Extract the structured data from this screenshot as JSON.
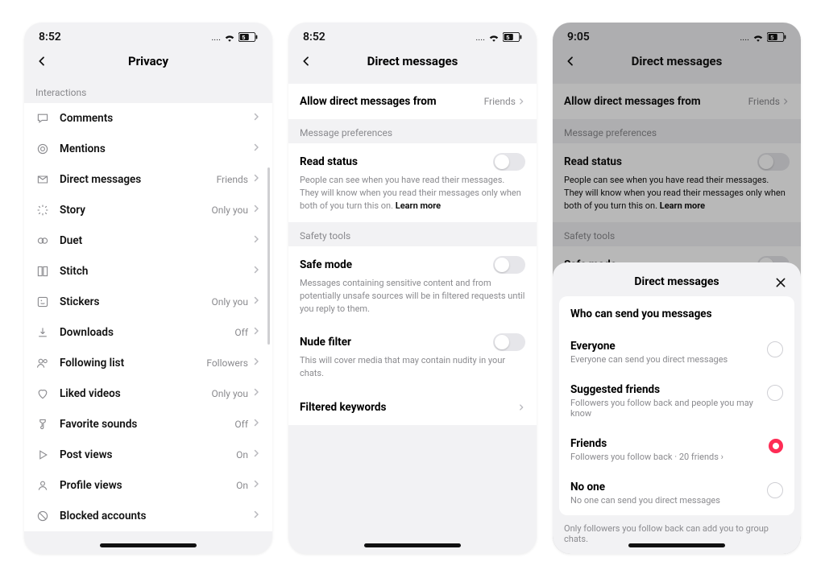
{
  "phones": {
    "privacy": {
      "time": "8:52",
      "status_dots": "....",
      "battery": "5",
      "title": "Privacy",
      "section": "Interactions",
      "rows": [
        {
          "k": "comments",
          "label": "Comments",
          "value": ""
        },
        {
          "k": "mentions",
          "label": "Mentions",
          "value": ""
        },
        {
          "k": "dm",
          "label": "Direct messages",
          "value": "Friends"
        },
        {
          "k": "story",
          "label": "Story",
          "value": "Only you"
        },
        {
          "k": "duet",
          "label": "Duet",
          "value": ""
        },
        {
          "k": "stitch",
          "label": "Stitch",
          "value": ""
        },
        {
          "k": "stickers",
          "label": "Stickers",
          "value": "Only you"
        },
        {
          "k": "downloads",
          "label": "Downloads",
          "value": "Off"
        },
        {
          "k": "following",
          "label": "Following list",
          "value": "Followers"
        },
        {
          "k": "liked",
          "label": "Liked videos",
          "value": "Only you"
        },
        {
          "k": "favsounds",
          "label": "Favorite sounds",
          "value": "Off"
        },
        {
          "k": "postviews",
          "label": "Post views",
          "value": "On"
        },
        {
          "k": "profileviews",
          "label": "Profile views",
          "value": "On"
        },
        {
          "k": "blocked",
          "label": "Blocked accounts",
          "value": ""
        }
      ]
    },
    "dm": {
      "time": "8:52",
      "status_dots": "....",
      "battery": "5",
      "title": "Direct messages",
      "allow_title": "Allow direct messages from",
      "allow_value": "Friends",
      "sec_pref": "Message preferences",
      "read_title": "Read status",
      "read_desc": "People can see when you have read their messages. They will know when you read their messages only when both of you turn this on. ",
      "learn_more": "Learn more",
      "sec_safety": "Safety tools",
      "safe_title": "Safe mode",
      "safe_desc": "Messages containing sensitive content and from potentially unsafe sources will be in filtered requests until you reply to them.",
      "nude_title": "Nude filter",
      "nude_desc": "This will cover media that may contain nudity in your chats.",
      "filtered_title": "Filtered keywords"
    },
    "sheet": {
      "time": "9:05",
      "status_dots": "....",
      "battery": "5",
      "bg_title": "Direct messages",
      "bg_allow_title": "Allow direct messages from",
      "bg_allow_value": "Friends",
      "bg_sec_pref": "Message preferences",
      "bg_read_title": "Read status",
      "bg_read_desc": "People can see when you have read their messages. They will know when you read their messages only when both of you turn this on. ",
      "bg_learn_more": "Learn more",
      "bg_sec_safety": "Safety tools",
      "bg_safe_title": "Safe mode",
      "sheet_title": "Direct messages",
      "question": "Who can send you messages",
      "options": [
        {
          "k": "everyone",
          "title": "Everyone",
          "desc": "Everyone can send you direct messages",
          "selected": false
        },
        {
          "k": "suggested",
          "title": "Suggested friends",
          "desc": "Followers you follow back and people you may know",
          "selected": false
        },
        {
          "k": "friends",
          "title": "Friends",
          "desc": "Followers you follow back · 20 friends ›",
          "selected": true
        },
        {
          "k": "noone",
          "title": "No one",
          "desc": "No one can send you direct messages",
          "selected": false
        }
      ],
      "footnote": "Only followers you follow back can add you to group chats."
    }
  }
}
